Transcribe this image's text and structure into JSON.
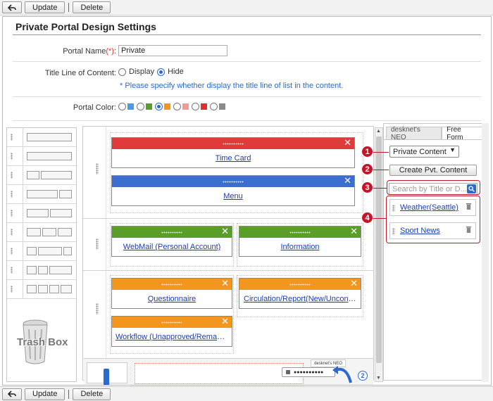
{
  "toolbar": {
    "update_label": "Update",
    "delete_label": "Delete"
  },
  "page": {
    "title": "Private Portal Design Settings"
  },
  "form": {
    "portal_name_label": "Portal Name",
    "required_mark": "(*)",
    "label_colon": ":",
    "portal_name_value": "Private",
    "title_line_label": "Title Line of Content:",
    "display_label": "Display",
    "hide_label": "Hide",
    "title_line_selected": "Hide",
    "title_line_note": "* Please specify whether display the title line of list in the content.",
    "portal_color_label": "Portal Color:",
    "colors": [
      "#4a9be0",
      "#5a9e2a",
      "#3a6fd0",
      "#f2961e",
      "#f29a9a",
      "#e02e2e",
      "#8a8a8a"
    ],
    "selected_color_index": 2
  },
  "canvas": {
    "portlets": [
      {
        "title": "Time Card",
        "color": "#e03a3a"
      },
      {
        "title": "Menu",
        "color": "#3a6fd0"
      },
      {
        "title": "WebMail (Personal Account)",
        "color": "#5a9e2a"
      },
      {
        "title": "Information",
        "color": "#5a9e2a"
      },
      {
        "title": "Questionnaire",
        "color": "#f2961e"
      },
      {
        "title": "Circulation/Report(New/Unconfirmed)",
        "color": "#f2961e"
      },
      {
        "title": "Workflow (Unapproved/Remanded)",
        "color": "#f2961e"
      }
    ],
    "close_glyph": "✕"
  },
  "trash": {
    "label": "Trash Box"
  },
  "right_panel": {
    "tabs": [
      "desknet's NEO",
      "Free Form"
    ],
    "active_tab": "Free Form",
    "select_value": "Private Content",
    "create_button": "Create Pvt. Content",
    "search_placeholder": "Search by Title or D...",
    "items": [
      "Weather(Seattle)",
      "Sport News"
    ]
  },
  "callouts": [
    "1",
    "2",
    "3",
    "4"
  ],
  "inset": {
    "tab_label": "desknet's NEO",
    "password_mask": "●●●●●●●●●●",
    "step": "2"
  },
  "colors": {
    "callout": "#c0182a",
    "link": "#1a3ea8",
    "note": "#2a6ad0"
  }
}
